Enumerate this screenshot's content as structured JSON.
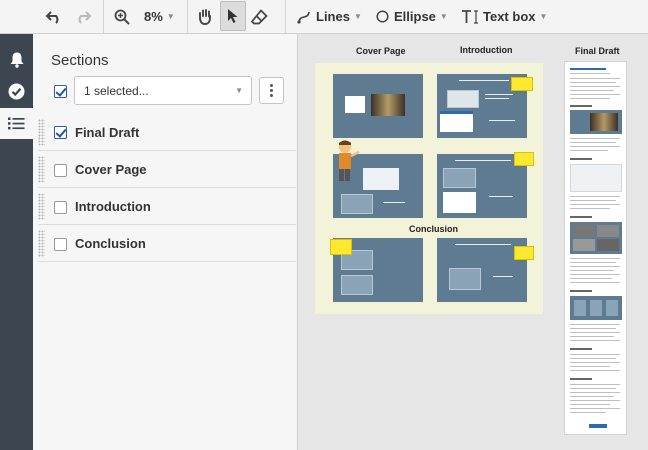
{
  "toolbar": {
    "zoom_value": "8%",
    "lines_label": "Lines",
    "ellipse_label": "Ellipse",
    "textbox_label": "Text box"
  },
  "sidebar_rail": {
    "items": [
      "bell-icon",
      "check-circle-icon",
      "list-icon"
    ],
    "active_index": 2
  },
  "sections_panel": {
    "title": "Sections",
    "select_value": "1 selected...",
    "select_all_checked": true,
    "rows": [
      {
        "label": "Final Draft",
        "checked": true
      },
      {
        "label": "Cover Page",
        "checked": false
      },
      {
        "label": "Introduction",
        "checked": false
      },
      {
        "label": "Conclusion",
        "checked": false
      }
    ]
  },
  "canvas": {
    "col_cover": "Cover Page",
    "col_intro": "Introduction",
    "col_final": "Final Draft",
    "col_conclusion": "Conclusion"
  },
  "colors": {
    "rail_bg": "#3d4650",
    "slide_bg": "#5e7b92",
    "board_bg": "#f3f3d9",
    "sticky": "#ffe830",
    "check_blue": "#1e56a0"
  }
}
